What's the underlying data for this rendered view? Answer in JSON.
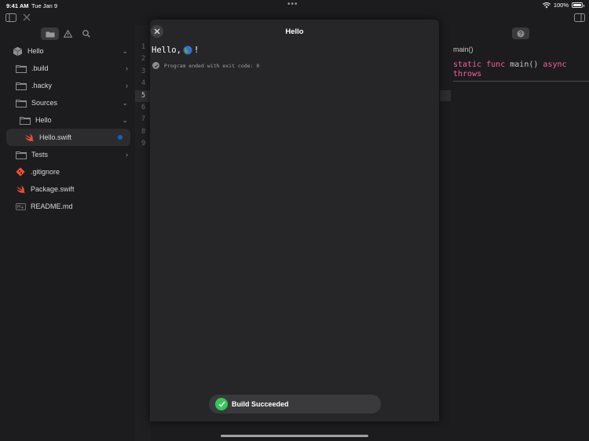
{
  "status": {
    "time": "9:41 AM",
    "date": "Tue Jan 9",
    "battery": "100%",
    "dots": "•••"
  },
  "sidebar": {
    "items": [
      {
        "label": "Hello",
        "icon": "package-cube-icon",
        "chevron": "⌄"
      },
      {
        "label": ".build",
        "icon": "folder-icon",
        "chevron": "›"
      },
      {
        "label": ".hacky",
        "icon": "folder-icon",
        "chevron": "›"
      },
      {
        "label": "Sources",
        "icon": "folder-icon",
        "chevron": "⌄"
      },
      {
        "label": "Hello",
        "icon": "folder-icon",
        "chevron": "⌄"
      },
      {
        "label": "Hello.swift",
        "icon": "swift-icon",
        "chevron": ""
      },
      {
        "label": "Tests",
        "icon": "folder-icon",
        "chevron": "›"
      },
      {
        "label": ".gitignore",
        "icon": "git-icon",
        "chevron": ""
      },
      {
        "label": "Package.swift",
        "icon": "swift-icon",
        "chevron": ""
      },
      {
        "label": "README.md",
        "icon": "markdown-icon",
        "chevron": ""
      }
    ]
  },
  "gutter": {
    "lines": [
      "1",
      "2",
      "3",
      "4",
      "5",
      "6",
      "7",
      "8",
      "9"
    ],
    "current_line": "5"
  },
  "inspector": {
    "title": "main()",
    "code_kw1": "static func",
    "code_name": " main() ",
    "code_kw2": "async",
    "code_kw3": "throws"
  },
  "modal": {
    "title": "Hello",
    "output_text": "Hello, ",
    "output_suffix": "!",
    "exit_text": "Program ended with exit code: 0"
  },
  "toast": {
    "label": "Build Succeeded"
  },
  "colors": {
    "accent": "#0a64c8",
    "success": "#34c759",
    "keyword": "#fc5fa3",
    "swift": "#f05138"
  }
}
